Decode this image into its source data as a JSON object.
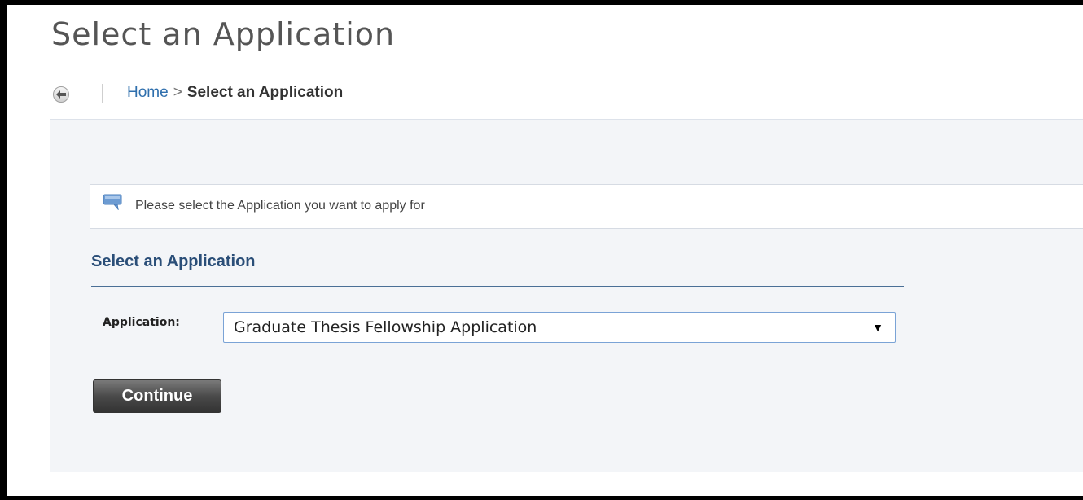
{
  "page": {
    "title": "Select an Application"
  },
  "breadcrumb": {
    "home_label": "Home",
    "separator": ">",
    "current_label": "Select an Application"
  },
  "info": {
    "message": "Please select the Application you want to apply for",
    "icon": "speech-bubble-icon"
  },
  "section": {
    "heading": "Select an Application"
  },
  "form": {
    "application_label": "Application:",
    "application_selected": "Graduate Thesis Fellowship Application",
    "dropdown_arrow": "▼"
  },
  "actions": {
    "continue_label": "Continue"
  },
  "colors": {
    "title": "#555555",
    "link": "#2f6fad",
    "section_heading": "#2a4e78",
    "panel_background": "#f3f5f8",
    "button": "#4a4a4a"
  }
}
